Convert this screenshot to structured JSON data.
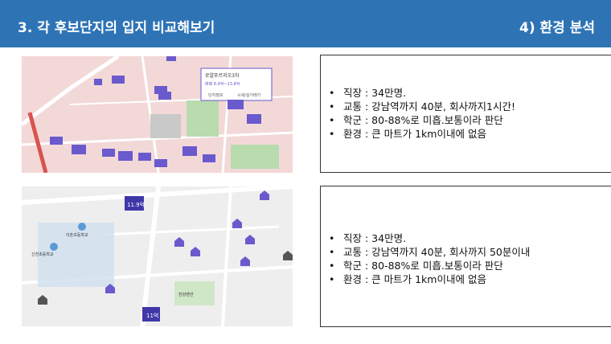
{
  "header": {
    "title": "3. 각 후보단지의 입지 비교해보기",
    "right": "4) 환경 분석"
  },
  "colors": {
    "header_bg": "#2e74b5",
    "marker": "#6a5acd",
    "map1_bg": "#f3d8d8",
    "map2_bg": "#eeeeee"
  },
  "map1": {
    "popup_title": "로얄푸르지오3차",
    "popup_line": "매매 8.9억~13.8억",
    "popup_btn_left": "단지정보",
    "popup_btn_right": "시세/실거래가"
  },
  "map2": {
    "price_top": "11.9억",
    "price_bottom": "11억",
    "label_school1": "이촌초등학교",
    "label_school2": "신천초등학교",
    "label_park": "한강맨션"
  },
  "box1": {
    "items": [
      "직장 : 34만명.",
      "교통 : 강남역까지 40분, 회사까지1시간!",
      "학군 : 80-88%로 미흡.보통이라 판단",
      "환경 : 큰 마트가 1km이내에 없음"
    ]
  },
  "box2": {
    "items": [
      "직장 : 34만명.",
      "교통 : 강남역까지 40분, 회사까지 50분이내",
      "학군 : 80-88%로 미흡.보통이라 판단",
      "환경 : 큰 마트가 1km이내에 없음"
    ]
  },
  "bullet": "•"
}
